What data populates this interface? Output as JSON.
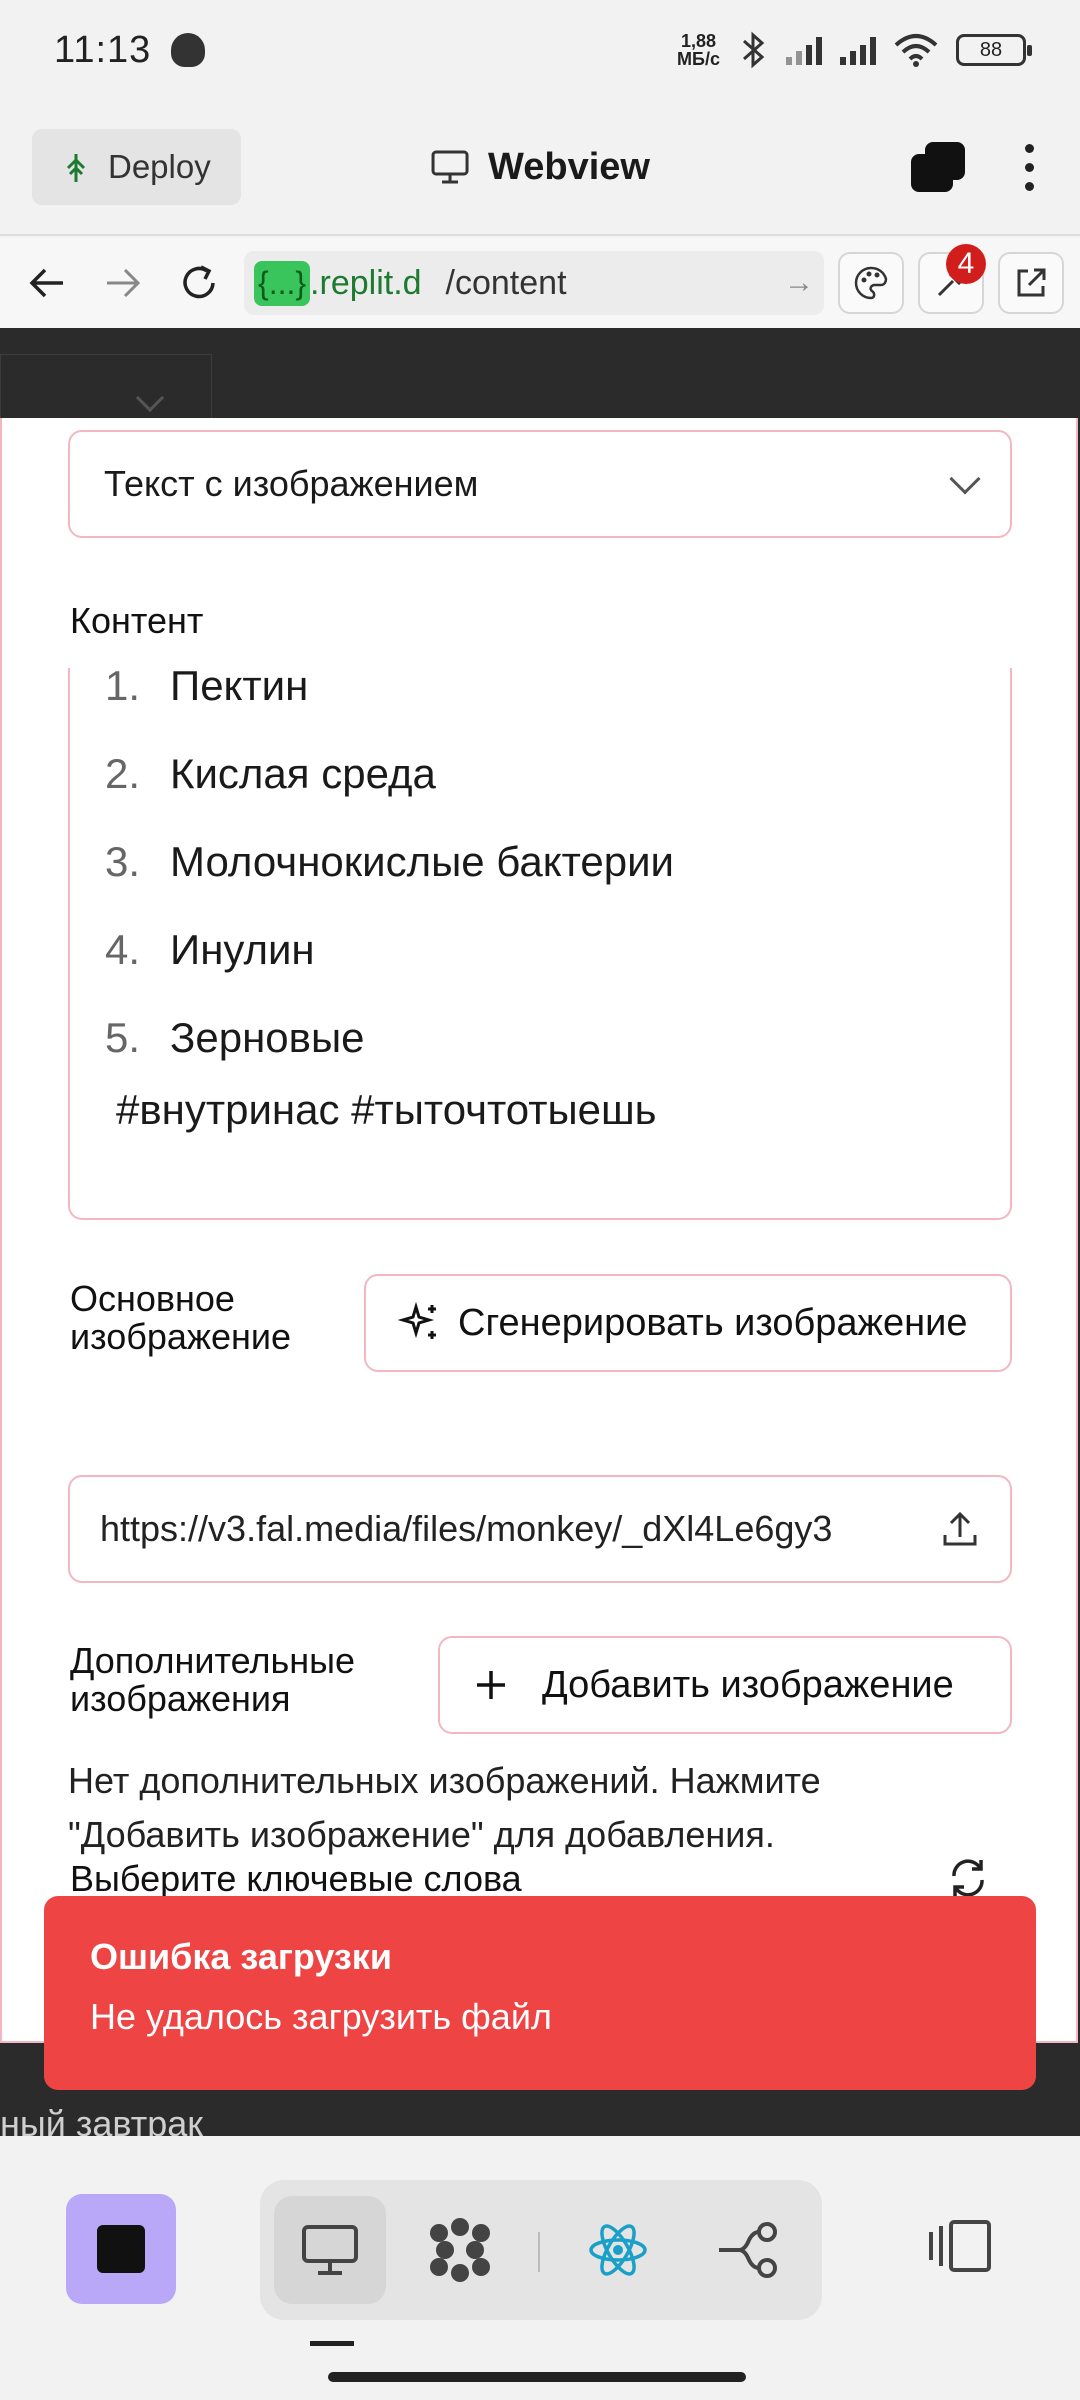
{
  "status_bar": {
    "time": "11:13",
    "net_speed_value": "1,88",
    "net_speed_unit": "МБ/с",
    "battery": "88"
  },
  "app_bar": {
    "deploy_label": "Deploy",
    "title": "Webview"
  },
  "browser": {
    "url_braces": "{...}",
    "url_host": ".replit.d",
    "url_path": "/content",
    "badge_count": "4"
  },
  "form": {
    "type_select_value": "Текст с изображением",
    "content_label": "Контент",
    "content_items": [
      {
        "num": "1.",
        "text": "Пектин"
      },
      {
        "num": "2.",
        "text": "Кислая среда"
      },
      {
        "num": "3.",
        "text": "Молочнокислые бактерии"
      },
      {
        "num": "4.",
        "text": "Инулин"
      },
      {
        "num": "5.",
        "text": "Зерновые"
      }
    ],
    "content_tags": "#внутринас #тыточтотыешь",
    "main_image_label_1": "Основное",
    "main_image_label_2": "изображение",
    "generate_button": "Сгенерировать изображение",
    "main_image_url": "https://v3.fal.media/files/monkey/_dXl4Le6gy3",
    "extra_images_label_1": "Дополнительные",
    "extra_images_label_2": "изображения",
    "add_image_button": "Добавить изображение",
    "no_extra_images_hint": "Нет дополнительных изображений. Нажмите \"Добавить изображение\" для добавления.",
    "keywords_label": "Выберите ключевые слова"
  },
  "toast": {
    "title": "Ошибка загрузки",
    "message": "Не удалось загрузить файл"
  },
  "background_peek_text": "ный завтрак",
  "colors": {
    "accent_border": "#f3b7c2",
    "toast_bg": "#ef4444",
    "stop_button_bg": "#b8a8f7",
    "url_green": "#3ac45c"
  }
}
